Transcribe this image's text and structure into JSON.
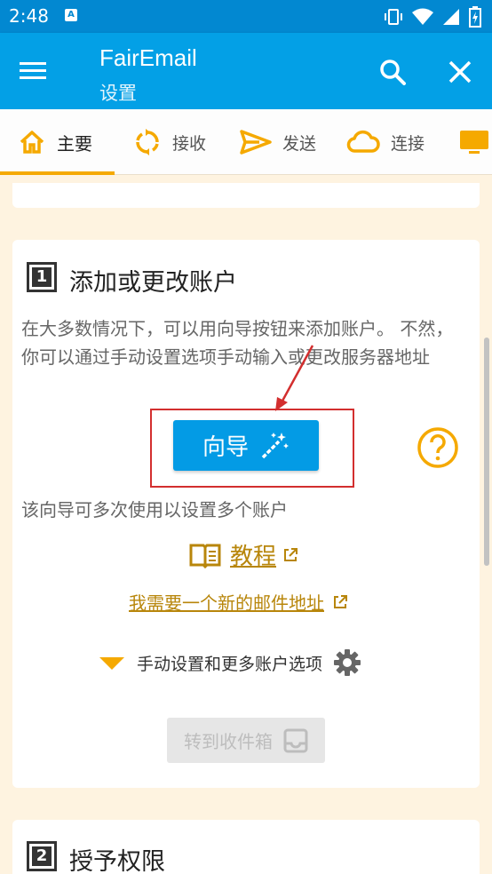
{
  "status": {
    "time": "2:48",
    "notif_letter": "A"
  },
  "appbar": {
    "title": "FairEmail",
    "subtitle": "设置"
  },
  "tabs": [
    {
      "label": "主要",
      "icon": "home-icon"
    },
    {
      "label": "接收",
      "icon": "sync-icon"
    },
    {
      "label": "发送",
      "icon": "send-icon"
    },
    {
      "label": "连接",
      "icon": "cloud-icon"
    },
    {
      "label": "",
      "icon": "monitor-icon"
    }
  ],
  "step1": {
    "number": "1",
    "title": "添加或更改账户",
    "description": "在大多数情况下，可以用向导按钮来添加账户。 不然，你可以通过手动设置选项手动输入或更改服务器地址",
    "wizard_label": "向导",
    "wizard_note": "该向导可多次使用以设置多个账户",
    "tutorial_label": "教程",
    "new_address_label": "我需要一个新的邮件地址",
    "manual_label": "手动设置和更多账户选项",
    "inbox_label": "转到收件箱"
  },
  "step2": {
    "number": "2",
    "title": "授予权限"
  },
  "colors": {
    "primary": "#03a0e6",
    "accent": "#f5a900",
    "link": "#b8860b",
    "annotation": "#d32f2f"
  }
}
